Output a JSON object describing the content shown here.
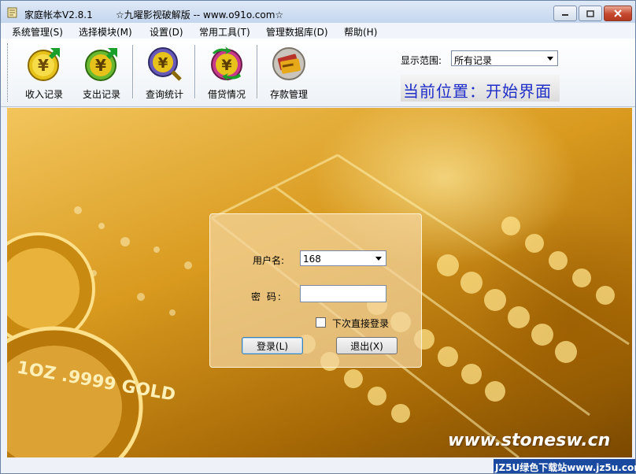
{
  "window": {
    "title": "家庭帐本V2.8.1",
    "title_extra": "☆九曜影视破解版 -- www.o91o.com☆"
  },
  "menu": [
    "系统管理(S)",
    "选择模块(M)",
    "设置(D)",
    "常用工具(T)",
    "管理数据库(D)",
    "帮助(H)"
  ],
  "toolbar": {
    "tools": [
      {
        "label": "收入记录",
        "icon": "income-yen-icon"
      },
      {
        "label": "支出记录",
        "icon": "expense-yen-icon"
      },
      {
        "label": "查询统计",
        "icon": "query-yen-icon"
      },
      {
        "label": "借贷情况",
        "icon": "loan-yen-icon"
      },
      {
        "label": "存款管理",
        "icon": "deposit-card-icon"
      }
    ],
    "range_label": "显示范围:",
    "range_value": "所有记录",
    "location_text": "当前位置：开始界面"
  },
  "login": {
    "username_label": "用户名:",
    "username_value": "168",
    "password_label": "密  码:",
    "remember_label": "下次直接登录",
    "login_button": "登录(L)",
    "exit_button": "退出(X)"
  },
  "background": {
    "coin_text": "1OZ .9999 GOLD",
    "watermark": "www.stonesw.cn"
  },
  "status": {
    "tag": "JZ5U绿色下载站www.jz5u.com"
  },
  "colors": {
    "location_text": "#1f2dc9",
    "gold": "#d99a1f",
    "status_tag": "#1a4aa0"
  }
}
